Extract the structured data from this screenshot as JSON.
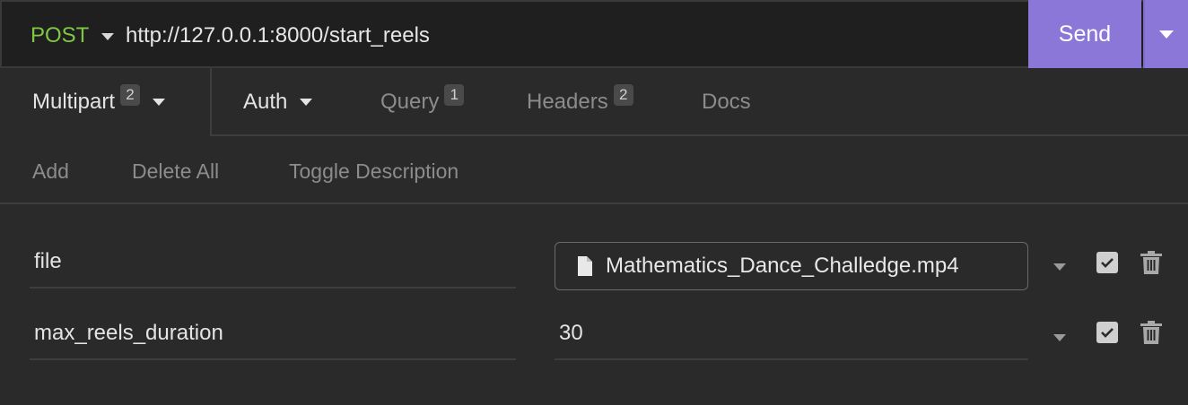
{
  "request": {
    "method": "POST",
    "url": "http://127.0.0.1:8000/start_reels",
    "send_label": "Send"
  },
  "tabs": [
    {
      "label": "Multipart",
      "badge": "2"
    },
    {
      "label": "Auth"
    },
    {
      "label": "Query",
      "badge": "1"
    },
    {
      "label": "Headers",
      "badge": "2"
    },
    {
      "label": "Docs"
    }
  ],
  "toolbar": {
    "add": "Add",
    "delete_all": "Delete All",
    "toggle_description": "Toggle Description"
  },
  "params": [
    {
      "name": "file",
      "value": "Mathematics_Dance_Challedge.mp4",
      "type": "file",
      "enabled": true
    },
    {
      "name": "max_reels_duration",
      "value": "30",
      "type": "text",
      "enabled": true
    }
  ],
  "colors": {
    "method": "#7ec842",
    "send": "#8a77d8",
    "background": "#2a2a2a"
  }
}
